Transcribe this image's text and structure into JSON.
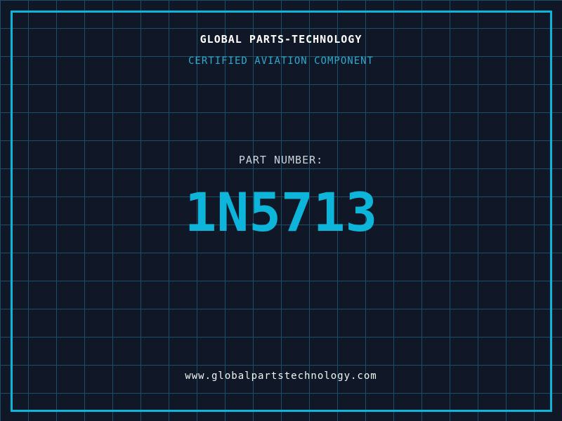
{
  "page": {
    "background_color": "#101827",
    "grid_line_color": "#1c4e64",
    "grid_cell_size_px": 40,
    "frame_color": "#0db5da"
  },
  "header": {
    "company": "GLOBAL PARTS-TECHNOLOGY",
    "subtitle": "CERTIFIED AVIATION COMPONENT",
    "company_color": "#ffffff",
    "subtitle_color": "#2fa9cd"
  },
  "part": {
    "label": "PART NUMBER:",
    "number": "1N5713",
    "label_color": "#ccd3dc",
    "number_color": "#0db5da"
  },
  "footer": {
    "website": "www.globalpartstechnology.com",
    "website_color": "#f2f5f8"
  }
}
